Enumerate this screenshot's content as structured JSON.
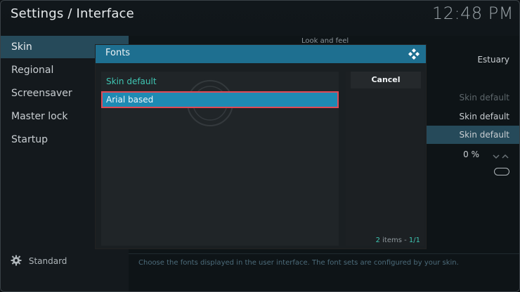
{
  "header": {
    "title": "Settings / Interface",
    "clock": "12:48 PM"
  },
  "sidebar": {
    "items": [
      {
        "label": "Skin",
        "active": true
      },
      {
        "label": "Regional",
        "active": false
      },
      {
        "label": "Screensaver",
        "active": false
      },
      {
        "label": "Master lock",
        "active": false
      },
      {
        "label": "Startup",
        "active": false
      }
    ],
    "footer": {
      "icon": "gear-icon",
      "label": "Standard"
    }
  },
  "content": {
    "section_label": "Look and feel",
    "values": {
      "skin": "Estuary",
      "theme": "Skin default",
      "colours": "Skin default",
      "fonts": "Skin default",
      "zoom": "0 %"
    },
    "hint": "Choose the fonts displayed in the user interface. The font sets are configured by your skin."
  },
  "dialog": {
    "title": "Fonts",
    "logo_icon": "kodi-logo-icon",
    "options": [
      {
        "label": "Skin default",
        "selected": false
      },
      {
        "label": "Arial based",
        "selected": true
      }
    ],
    "cancel_label": "Cancel",
    "items_count": "2",
    "items_suffix": "items - ",
    "page": "1/1"
  },
  "colors": {
    "header_bar": "#1e6f90",
    "selected_item": "#1e8ab3",
    "highlight_outline": "#e04a56",
    "accent_text": "#3fc6b3",
    "active_sidebar": "#264a5a"
  }
}
